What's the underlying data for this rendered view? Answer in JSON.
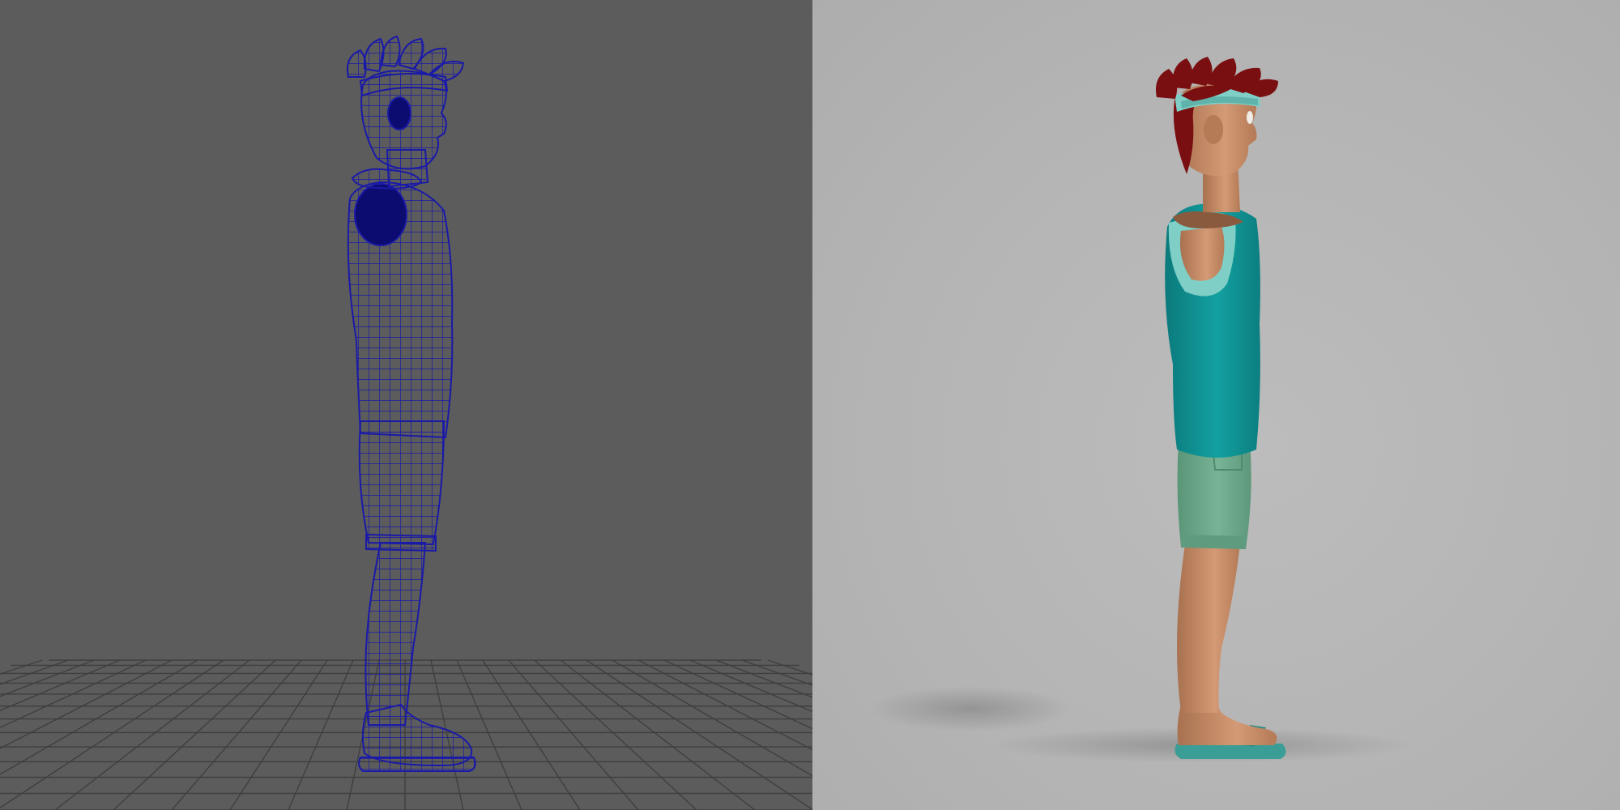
{
  "scene": {
    "panels": [
      {
        "name": "wireframe-viewport",
        "background": "#5c5c5c",
        "mesh_color": "#1a1aa8",
        "grid_color": "#3f3f3f"
      },
      {
        "name": "render-viewport",
        "background": "#b5b5b5"
      }
    ],
    "character": {
      "hair_color": "#7a0f12",
      "headband_color": "#7fcfc6",
      "skin_color": "#c98e6a",
      "tank_top_color": "#0f8f8f",
      "shorts_color": "#6aa589",
      "sandal_color": "#3a9d96"
    }
  }
}
